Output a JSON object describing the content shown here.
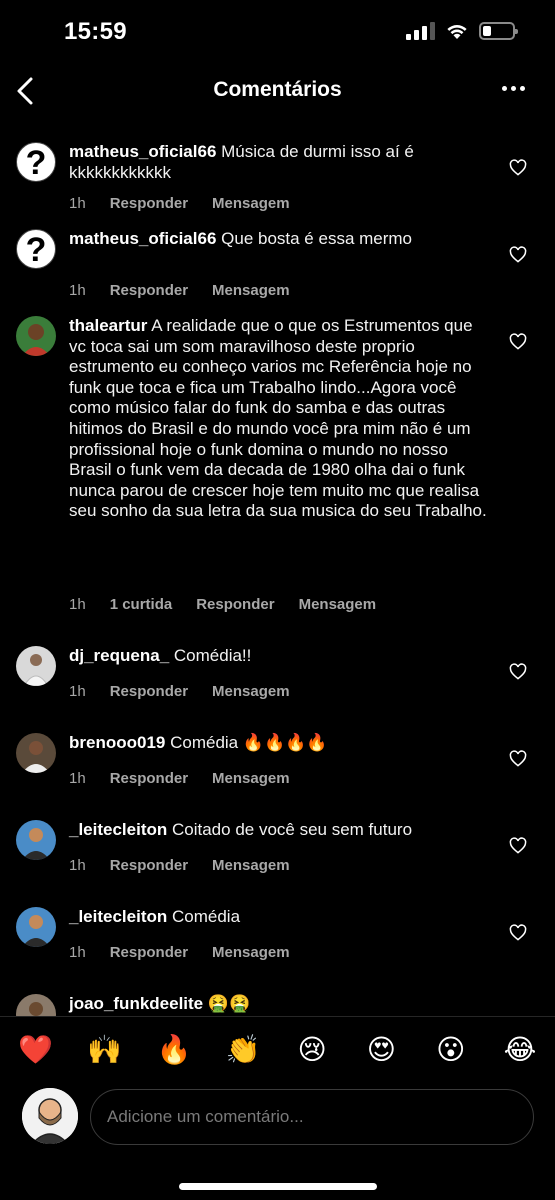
{
  "status_bar": {
    "time": "15:59",
    "battery_level": 0.3
  },
  "header": {
    "title": "Comentários",
    "back_icon": "chevron-left-icon",
    "more_icon": "ellipsis-icon"
  },
  "comments": [
    {
      "username": "matheus_oficial66",
      "text": "Música de durmi isso aí é kkkkkkkkkkkk",
      "time": "1h",
      "likes": "",
      "reply": "Responder",
      "message": "Mensagem",
      "avatar": "question-mark"
    },
    {
      "username": "matheus_oficial66",
      "text": "Que bosta é essa mermo",
      "time": "1h",
      "likes": "",
      "reply": "Responder",
      "message": "Mensagem",
      "avatar": "question-mark"
    },
    {
      "username": "thaleartur",
      "text": "A realidade que o que os Estrumentos que vc toca sai um som  maravilhoso deste proprio estrumento eu conheço varios mc Referência hoje no funk que toca e fica um Trabalho lindo...Agora você como músico falar do funk do samba e das outras hitimos do Brasil e do mundo você pra mim não é um profissional hoje o funk domina o mundo no nosso Brasil o funk vem da decada de 1980 olha dai o funk nunca parou de crescer hoje tem muito mc que realisa seu sonho da sua letra da sua musica do seu Trabalho.",
      "time": "1h",
      "likes": "1 curtida",
      "reply": "Responder",
      "message": "Mensagem",
      "avatar": "photo"
    },
    {
      "username": "dj_requena_",
      "text": "Comédia!!",
      "time": "1h",
      "likes": "",
      "reply": "Responder",
      "message": "Mensagem",
      "avatar": "photo"
    },
    {
      "username": "brenooo019",
      "text": "Comédia 🔥🔥🔥🔥",
      "time": "1h",
      "likes": "",
      "reply": "Responder",
      "message": "Mensagem",
      "avatar": "photo"
    },
    {
      "username": "_leitecleiton",
      "text": "Coitado de você seu sem futuro",
      "time": "1h",
      "likes": "",
      "reply": "Responder",
      "message": "Mensagem",
      "avatar": "photo"
    },
    {
      "username": "_leitecleiton",
      "text": "Comédia",
      "time": "1h",
      "likes": "",
      "reply": "Responder",
      "message": "Mensagem",
      "avatar": "photo"
    },
    {
      "username": "joao_funkdeelite",
      "text": "🤮🤮",
      "avatar": "photo"
    }
  ],
  "emoji_bar": [
    "❤️",
    "🙌",
    "🔥",
    "👏",
    "😢",
    "😍",
    "😮",
    "😂"
  ],
  "input": {
    "placeholder": "Adicione um comentário..."
  }
}
